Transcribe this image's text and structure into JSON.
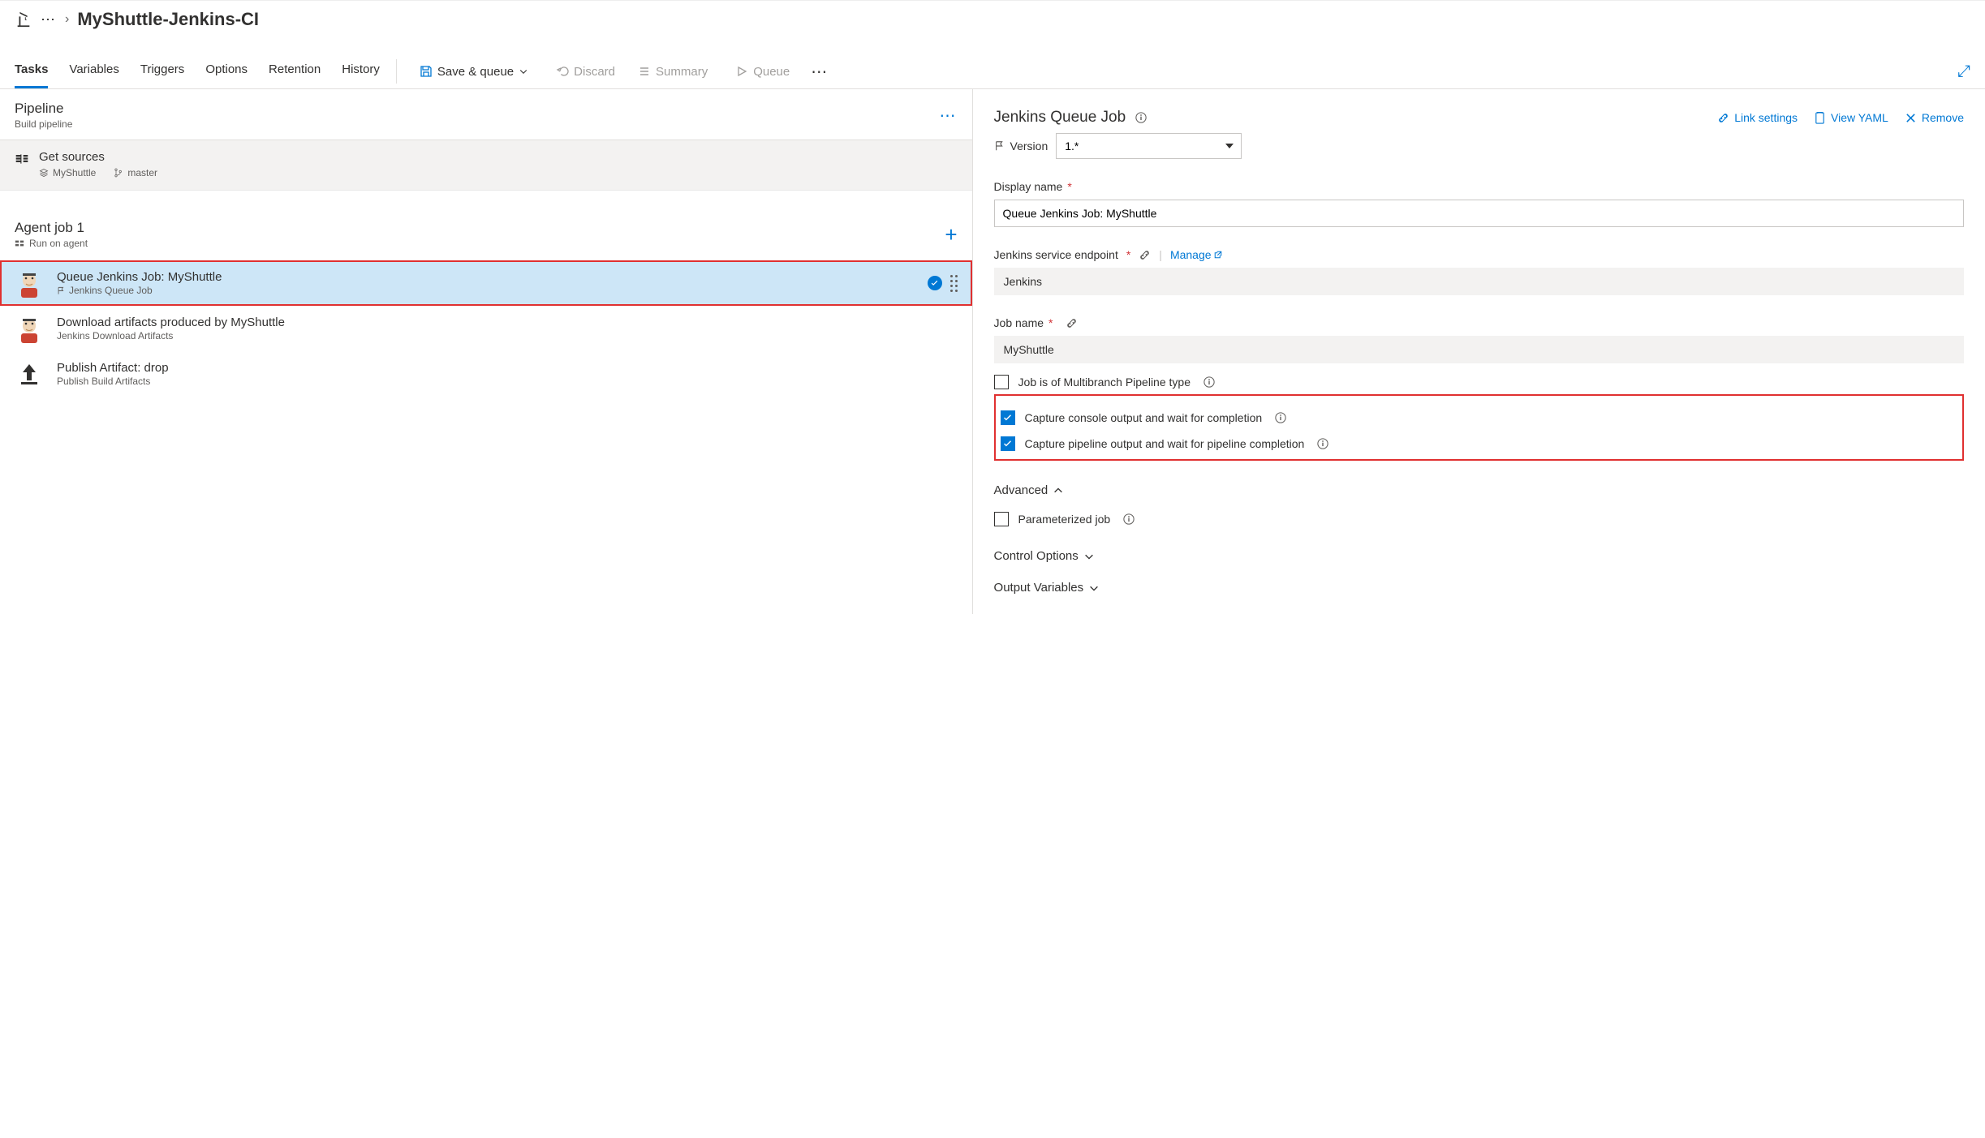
{
  "breadcrumb": {
    "title": "MyShuttle-Jenkins-CI"
  },
  "tabs": [
    "Tasks",
    "Variables",
    "Triggers",
    "Options",
    "Retention",
    "History"
  ],
  "activeTab": "Tasks",
  "toolbar": {
    "save": "Save & queue",
    "discard": "Discard",
    "summary": "Summary",
    "queue": "Queue"
  },
  "pipeline": {
    "title": "Pipeline",
    "sub": "Build pipeline"
  },
  "sources": {
    "title": "Get sources",
    "repo": "MyShuttle",
    "branch": "master"
  },
  "agent": {
    "title": "Agent job 1",
    "sub": "Run on agent"
  },
  "tasks": [
    {
      "title": "Queue Jenkins Job: MyShuttle",
      "sub": "Jenkins Queue Job",
      "selected": true,
      "icon": "jenkins"
    },
    {
      "title": "Download artifacts produced by MyShuttle",
      "sub": "Jenkins Download Artifacts",
      "selected": false,
      "icon": "jenkins"
    },
    {
      "title": "Publish Artifact: drop",
      "sub": "Publish Build Artifacts",
      "selected": false,
      "icon": "upload"
    }
  ],
  "details": {
    "header": "Jenkins Queue Job",
    "actions": {
      "link": "Link settings",
      "yaml": "View YAML",
      "remove": "Remove"
    },
    "versionLabel": "Version",
    "versionValue": "1.*",
    "displayNameLabel": "Display name",
    "displayNameValue": "Queue Jenkins Job: MyShuttle",
    "endpointLabel": "Jenkins service endpoint",
    "manage": "Manage",
    "endpointValue": "Jenkins",
    "jobNameLabel": "Job name",
    "jobNameValue": "MyShuttle",
    "cbMultibranch": "Job is of Multibranch Pipeline type",
    "cbConsole": "Capture console output and wait for completion",
    "cbPipeline": "Capture pipeline output and wait for pipeline completion",
    "advanced": "Advanced",
    "paramJob": "Parameterized job",
    "controlOptions": "Control Options",
    "outputVars": "Output Variables"
  }
}
